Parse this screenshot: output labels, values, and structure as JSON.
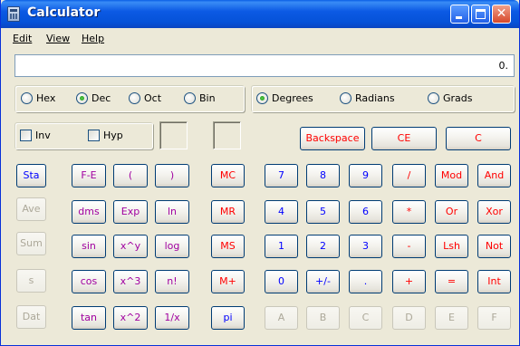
{
  "window": {
    "title": "Calculator"
  },
  "menu": [
    {
      "label": "Edit"
    },
    {
      "label": "View"
    },
    {
      "label": "Help"
    }
  ],
  "display": {
    "value": "0."
  },
  "number_system": [
    {
      "label": "Hex",
      "selected": false
    },
    {
      "label": "Dec",
      "selected": true
    },
    {
      "label": "Oct",
      "selected": false
    },
    {
      "label": "Bin",
      "selected": false
    }
  ],
  "angle_mode": [
    {
      "label": "Degrees",
      "selected": true
    },
    {
      "label": "Radians",
      "selected": false
    },
    {
      "label": "Grads",
      "selected": false
    }
  ],
  "modifiers": [
    {
      "label": "Inv",
      "checked": false
    },
    {
      "label": "Hyp",
      "checked": false
    }
  ],
  "edit_buttons": {
    "backspace": "Backspace",
    "ce": "CE",
    "c": "C"
  },
  "stat_buttons": [
    "Sta",
    "Ave",
    "Sum",
    "s",
    "Dat"
  ],
  "func_buttons": [
    [
      "F-E",
      "(",
      ")"
    ],
    [
      "dms",
      "Exp",
      "ln"
    ],
    [
      "sin",
      "x^y",
      "log"
    ],
    [
      "cos",
      "x^3",
      "n!"
    ],
    [
      "tan",
      "x^2",
      "1/x"
    ]
  ],
  "memory_buttons": [
    "MC",
    "MR",
    "MS",
    "M+",
    "pi"
  ],
  "keypad_buttons": [
    [
      "7",
      "8",
      "9",
      "/",
      "Mod",
      "And"
    ],
    [
      "4",
      "5",
      "6",
      "*",
      "Or",
      "Xor"
    ],
    [
      "1",
      "2",
      "3",
      "-",
      "Lsh",
      "Not"
    ],
    [
      "0",
      "+/-",
      ".",
      "+",
      "=",
      "Int"
    ],
    [
      "A",
      "B",
      "C",
      "D",
      "E",
      "F"
    ]
  ]
}
